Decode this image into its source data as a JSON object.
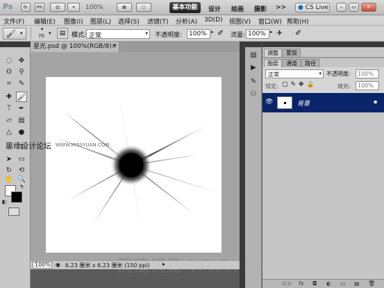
{
  "appbar": {
    "logo": "Ps",
    "icons": [
      {
        "name": "bridge",
        "label": "Br"
      },
      {
        "name": "minibridge",
        "label": "Mb"
      },
      {
        "name": "view-extras",
        "label": "▥"
      }
    ],
    "zoom": "100%",
    "workspaces": [
      "基本功能",
      "设计",
      "绘画",
      "摄影"
    ],
    "more": ">>",
    "cslive": "CS Live",
    "window_buttons": [
      "–",
      "▭",
      "✕"
    ]
  },
  "menubar": {
    "items": [
      "文件(F)",
      "编辑(E)",
      "图像(I)",
      "图层(L)",
      "选择(S)",
      "滤镜(T)",
      "分析(A)",
      "3D(D)",
      "视图(V)",
      "窗口(W)",
      "帮助(H)"
    ]
  },
  "options": {
    "brush_size": "70",
    "mode_label": "模式:",
    "mode_value": "正常",
    "opacity_label": "不透明度:",
    "opacity_value": "100%",
    "flow_label": "流量:",
    "flow_value": "100%"
  },
  "document": {
    "tab_title": "星光.psd @ 100%(RGB/8) *",
    "close": "×"
  },
  "status": {
    "zoom": "100%",
    "info": "6.23 厘米 x 6.23 厘米 (150 ppi)"
  },
  "panels": {
    "top_tabs": [
      "调整",
      "蒙版"
    ],
    "layer_tabs": [
      "图层",
      "通道",
      "路径"
    ],
    "blend_mode": "正常",
    "opacity_label": "不透明度:",
    "opacity_value": "100%",
    "lock_label": "锁定:",
    "fill_label": "填充:",
    "fill_value": "100%",
    "layer_name": "背景",
    "footer_icons": [
      "⊂⊃",
      "fx",
      "◘",
      "◐",
      "▭",
      "▤",
      "🗑"
    ]
  },
  "watermarks": {
    "left_cn": "思缘设计论坛",
    "left_url": "WWW.MISSYUAN.COM",
    "bottom": "腾龍視覺 WWW.TLVI.NET"
  },
  "colors": {
    "selected_layer": "#0a246a",
    "workspace_active": "#222222"
  }
}
